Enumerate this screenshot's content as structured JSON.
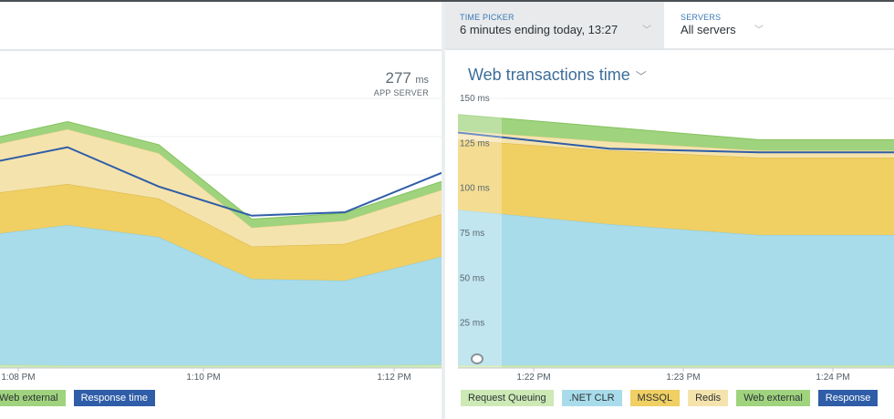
{
  "toolbar": {
    "time_picker_label": "TIME PICKER",
    "time_picker_value": "6 minutes ending today, 13:27",
    "servers_label": "SERVERS",
    "servers_value": "All servers"
  },
  "left_chart": {
    "value": "277",
    "unit": "ms",
    "subtitle": "APP SERVER",
    "x_ticks": [
      "1:08 PM",
      "1:10 PM",
      "1:12 PM"
    ],
    "legend": [
      "Web external",
      "Response time"
    ]
  },
  "right_chart": {
    "title": "Web transactions time",
    "legend": [
      "Request Queuing",
      ".NET CLR",
      "MSSQL",
      "Redis",
      "Web external",
      "Response"
    ]
  },
  "colors": {
    "request_queuing": "#cde9b5",
    "net_clr": "#a8dcea",
    "mssql": "#f0cf63",
    "redis": "#f5e3ad",
    "web_external": "#9fd37d",
    "response_time": "#2f5da7"
  },
  "chart_data": [
    {
      "type": "area",
      "title": "",
      "x": [
        "1:08 PM",
        "1:10 PM",
        "1:12 PM"
      ],
      "series": [
        {
          "name": "Request Queuing",
          "values": [
            4,
            3,
            3,
            3,
            3,
            4
          ]
        },
        {
          "name": ".NET CLR",
          "values": [
            152,
            164,
            150,
            101,
            99,
            126
          ]
        },
        {
          "name": "MSSQL",
          "values": [
            48,
            48,
            45,
            38,
            43,
            50
          ]
        },
        {
          "name": "Redis",
          "values": [
            56,
            64,
            53,
            22,
            27,
            28
          ]
        },
        {
          "name": "Web external",
          "values": [
            8,
            9,
            10,
            10,
            9,
            10
          ]
        },
        {
          "name": "Response time",
          "values": [
            240,
            258,
            212,
            178,
            182,
            228
          ]
        }
      ],
      "ylim": [
        0,
        330
      ]
    },
    {
      "type": "area",
      "title": "Web transactions time",
      "x": [
        "1:22 PM",
        "1:23 PM",
        "1:24 PM"
      ],
      "y_ticks": [
        "150 ms",
        "125 ms",
        "100 ms",
        "75 ms",
        "50 ms",
        "25 ms"
      ],
      "series": [
        {
          "name": "Request Queuing",
          "values": [
            1.5,
            1.5,
            1.5,
            1.5
          ]
        },
        {
          "name": ".NET CLR",
          "values": [
            86.5,
            78.5,
            72.5,
            72.5
          ]
        },
        {
          "name": "MSSQL",
          "values": [
            39,
            41,
            43,
            43
          ]
        },
        {
          "name": "Redis",
          "values": [
            5,
            5,
            4,
            4
          ]
        },
        {
          "name": "Web external",
          "values": [
            9,
            8,
            6,
            6
          ]
        },
        {
          "name": "Response time",
          "values": [
            131,
            122,
            120,
            120
          ]
        }
      ],
      "ylim": [
        0,
        150
      ]
    }
  ]
}
